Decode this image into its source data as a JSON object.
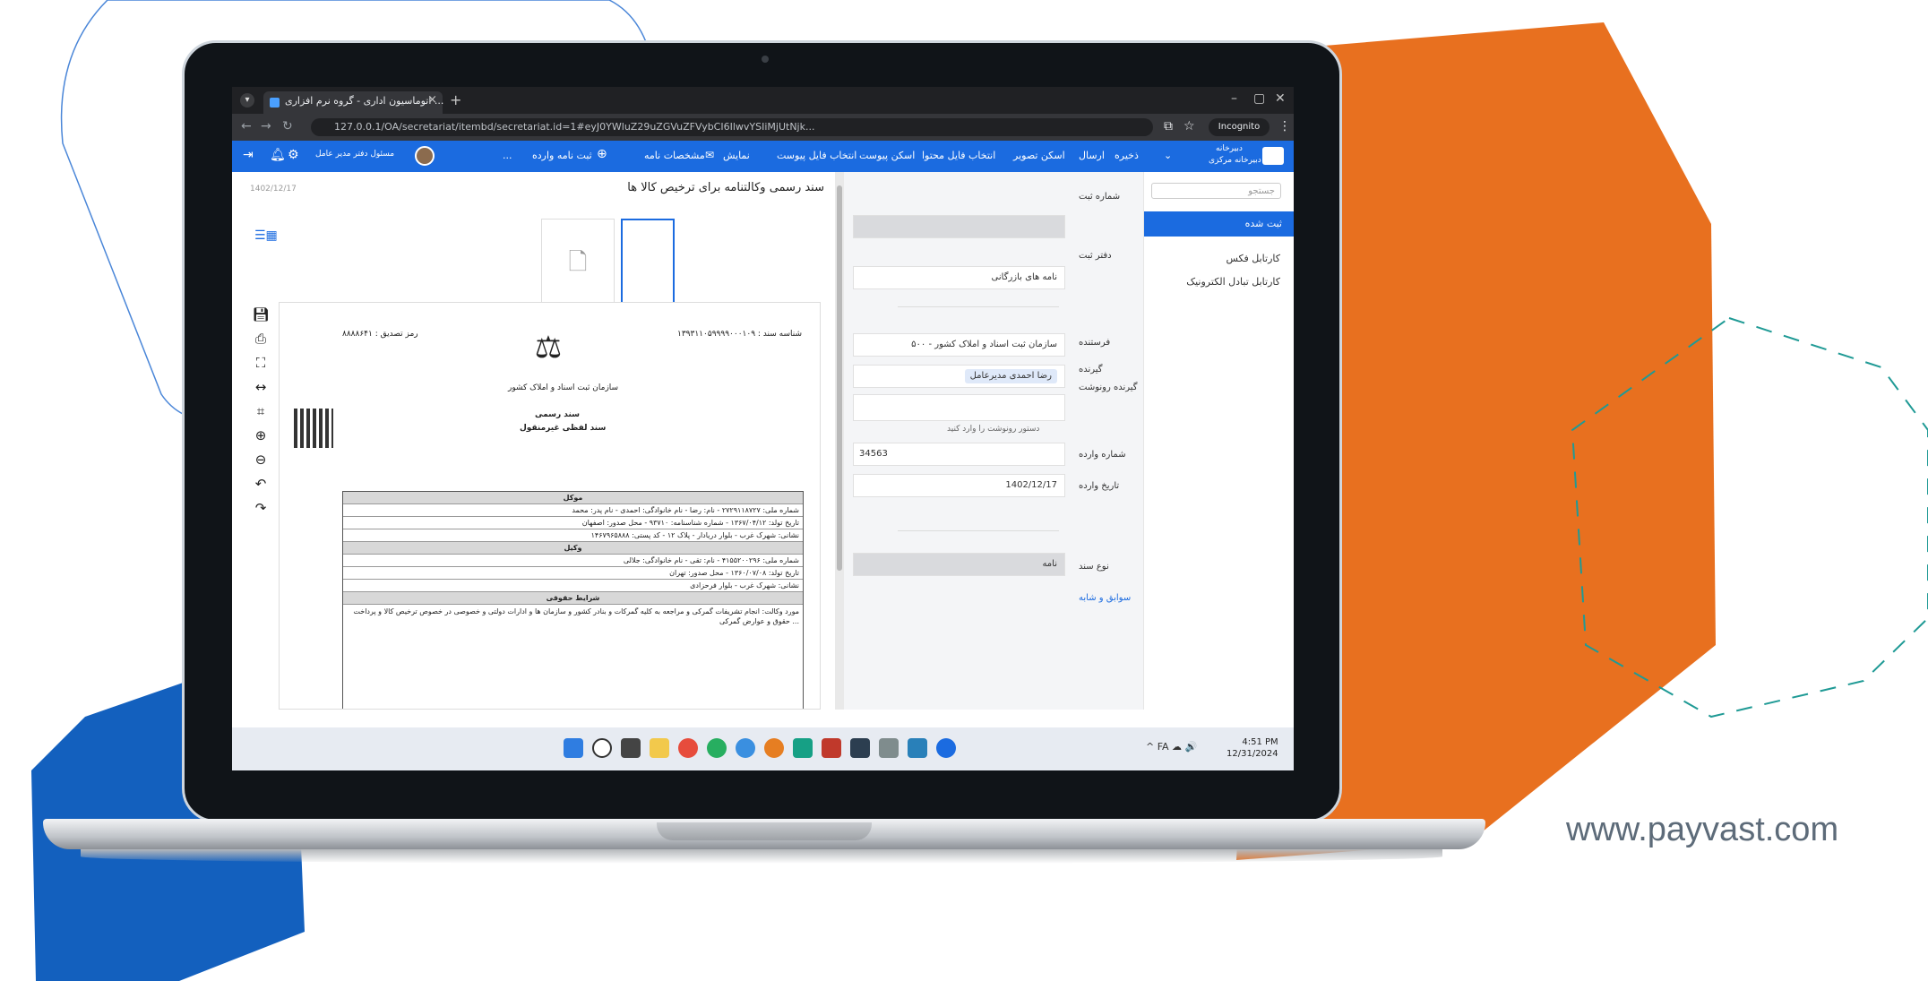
{
  "website": "www.payvast.com",
  "browser": {
    "tab_title": "اتوماسیون اداری - گروه نرم افزاری ...",
    "new_tab": "+",
    "window_controls": [
      "–",
      "▢",
      "✕"
    ],
    "url": "127.0.0.1/OA/secretariat/itembd/secretariat.id=1#eyJ0YWluZ29uZGVuZFVybCI6IlwvYSIiMjUtNjk...",
    "incognito_label": "Incognito"
  },
  "toolbar": {
    "brand_line1": "دبیرخانه",
    "brand_line2": "دبیرخانه مرکزی",
    "items": [
      "ذخیره",
      "ارسال",
      "اسکن تصویر",
      "انتخاب فایل محتوا",
      "اسکن پیوست",
      "انتخاب فایل پیوست",
      "نمایش",
      "مشخصات نامه",
      "ثبت نامه وارده",
      "..."
    ],
    "user": "مسئول دفتر مدیر عامل"
  },
  "sidenav": {
    "search_placeholder": "جستجو",
    "active": "ثبت شده",
    "items": [
      "کارتابل فکس",
      "کارتابل تبادل الکترونیک"
    ]
  },
  "form": {
    "fields": [
      {
        "label": "شماره ثبت",
        "value": ""
      },
      {
        "label": "دفتر ثبت",
        "value": "نامه های بازرگانی"
      },
      {
        "label": "فرستنده",
        "value": "۵۰۰ - سازمان ثبت اسناد و املاک کشور"
      },
      {
        "label": "گیرنده",
        "value": "رضا احمدی مدیرعامل"
      },
      {
        "label": "گیرنده رونوشت",
        "value": ""
      },
      {
        "label": "شماره وارده",
        "value": "34563"
      },
      {
        "label": "تاریخ وارده",
        "value": "1402/12/17"
      },
      {
        "label": "نوع سند",
        "value": "نامه"
      }
    ],
    "cc_hint": "دستور رونوشت را وارد کنید",
    "link": "سوابق و شابه"
  },
  "document": {
    "title": "سند رسمی وکالتنامه برای ترخیص کالا ها",
    "date": "1402/12/17",
    "header_left": "رمز تصدیق : ۸۸۸۸۶۴۱",
    "header_right": "شناسه سند : ۱۳۹۳۱۱۰۵۹۹۹۹۰۰۰۱۰۹",
    "org": "سازمان ثبت اسناد و املاک کشور",
    "doc_type": "سند رسمی",
    "doc_subtitle": "سند لفظی غیرمنقول",
    "table_header": "موکل",
    "rows": [
      "شماره ملی: ۲۷۲۹۱۱۸۷۲۷ - نام: رضا - نام خانوادگی: احمدی - نام پدر: محمد",
      "تاریخ تولد: ۱۳۶۷/۰۴/۱۲ - شماره شناسنامه: ۹۳۷۱۰ - محل صدور: اصفهان",
      "نشانی: شهرک غرب - بلوار دریادار - پلاک ۱۲ - کد پستی: ۱۴۶۷۹۶۵۸۸۸",
      "وکیل",
      "شماره ملی: ۴۱۵۵۲۰۰۲۹۶ - نام: تقی - نام خانوادگی: جلالی",
      "تاریخ تولد: ۱۳۶۰/۰۷/۰۸ - محل صدور: تهران",
      "نشانی: شهرک غرب - بلوار فرحزادی"
    ],
    "terms_header": "شرایط حقوقی",
    "terms_text": "مورد وکالت: انجام تشریفات گمرکی و مراجعه به کلیه گمرکات و بنادر کشور و سازمان ها و ادارات دولتی و خصوصی در خصوص ترخیص کالا و پرداخت حقوق و عوارض گمرکی ..."
  },
  "taskbar": {
    "tray": "^  FA  ☁ 🔊",
    "time": "4:51 PM",
    "date": "12/31/2024"
  },
  "colors": {
    "primary": "#1b6be0",
    "orange": "#e8701f",
    "blue_shape": "#1360be"
  }
}
